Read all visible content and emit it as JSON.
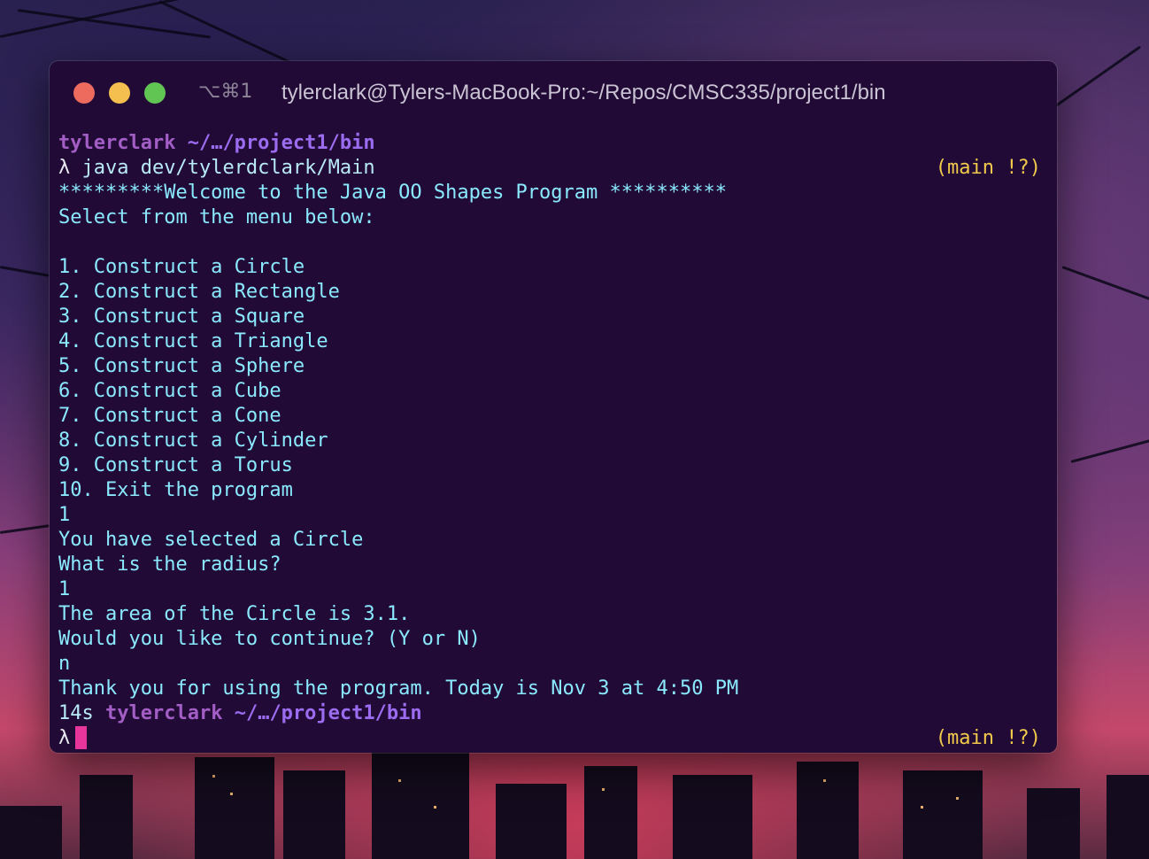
{
  "window": {
    "shortcut": "⌥⌘1",
    "title": "tylerclark@Tylers-MacBook-Pro:~/Repos/CMSC335/project1/bin"
  },
  "terminal": {
    "prompt1": {
      "user": "tylerclark",
      "path": "~/…/project1/bin"
    },
    "command_line": {
      "symbol": "λ",
      "command": "java dev/tylerdclark/Main",
      "git": "(main !?)"
    },
    "output": [
      "*********Welcome to the Java OO Shapes Program **********",
      "Select from the menu below:",
      "",
      "1. Construct a Circle",
      "2. Construct a Rectangle",
      "3. Construct a Square",
      "4. Construct a Triangle",
      "5. Construct a Sphere",
      "6. Construct a Cube",
      "7. Construct a Cone",
      "8. Construct a Cylinder",
      "9. Construct a Torus",
      "10. Exit the program",
      "1",
      "You have selected a Circle",
      "What is the radius?",
      "1",
      "The area of the Circle is 3.1.",
      "Would you like to continue? (Y or N)",
      "n",
      "Thank you for using the program. Today is Nov 3 at 4:50 PM"
    ],
    "prompt2": {
      "duration": "14s",
      "user": "tylerclark",
      "path": "~/…/project1/bin"
    },
    "input_line": {
      "symbol": "λ",
      "git": "(main !?)"
    }
  }
}
